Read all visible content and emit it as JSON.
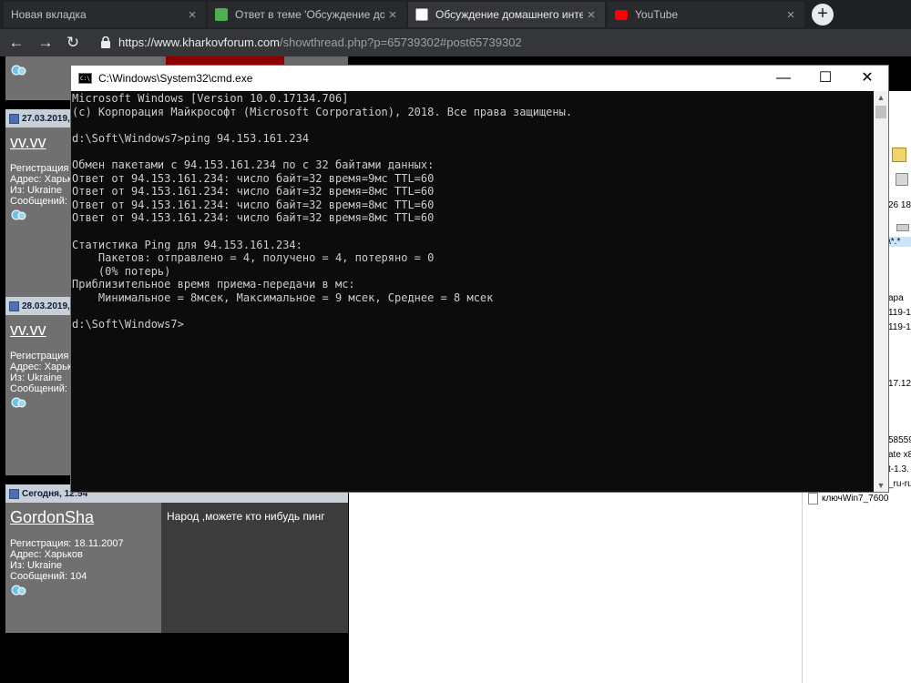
{
  "browser": {
    "tabs": [
      {
        "title": "Новая вкладка",
        "active": false
      },
      {
        "title": "Ответ в теме 'Обсуждение дома",
        "active": false
      },
      {
        "title": "Обсуждение домашнего интерн",
        "active": true
      },
      {
        "title": "YouTube",
        "active": false
      }
    ],
    "url_main": "https://www.kharkovforum.com",
    "url_rest": "/showthread.php?p=65739302#post65739302",
    "colors": {
      "tabbar": "#202124",
      "toolbar": "#35363a"
    }
  },
  "forum": {
    "posts": [
      {
        "date": "27.03.2019,",
        "username": "vv.vv",
        "info": [
          "Регистрация",
          "Адрес: Харьк",
          "Из: Ukraine",
          "Сообщений:"
        ]
      },
      {
        "date": "28.03.2019,",
        "username": "vv.vv",
        "info": [
          "Регистрация",
          "Адрес: Харьк",
          "Из: Ukraine",
          "Сообщений:"
        ]
      },
      {
        "date": "Сегодня, 12:54",
        "username": "GordonSha",
        "info": [
          "Регистрация: 18.11.2007",
          "Адрес: Харьков",
          "Из: Ukraine",
          "Сообщений: 104"
        ],
        "message": "Народ ,можете кто нибудь пинг"
      }
    ]
  },
  "explorer": {
    "fragments": [
      "26 18",
      "\\*.*",
      "ара",
      "119-1",
      "119-1",
      "17.12",
      "58559",
      "ate x8",
      "t-1.3.",
      "_ru-ru"
    ],
    "file": "ключWin7_7600"
  },
  "cmd": {
    "title": "C:\\Windows\\System32\\cmd.exe",
    "icon_label": "C:\\",
    "buttons": {
      "minimize": "—",
      "maximize": "☐",
      "close": "✕"
    },
    "lines": [
      "Microsoft Windows [Version 10.0.17134.706]",
      "(c) Корпорация Майкрософт (Microsoft Corporation), 2018. Все права защищены.",
      "",
      "d:\\Soft\\Windows7>ping 94.153.161.234",
      "",
      "Обмен пакетами с 94.153.161.234 по с 32 байтами данных:",
      "Ответ от 94.153.161.234: число байт=32 время=9мс TTL=60",
      "Ответ от 94.153.161.234: число байт=32 время=8мс TTL=60",
      "Ответ от 94.153.161.234: число байт=32 время=8мс TTL=60",
      "Ответ от 94.153.161.234: число байт=32 время=8мс TTL=60",
      "",
      "Статистика Ping для 94.153.161.234:",
      "    Пакетов: отправлено = 4, получено = 4, потеряно = 0",
      "    (0% потерь)",
      "Приблизительное время приема-передачи в мс:",
      "    Минимальное = 8мсек, Максимальное = 9 мсек, Среднее = 8 мсек",
      "",
      "d:\\Soft\\Windows7>"
    ]
  }
}
